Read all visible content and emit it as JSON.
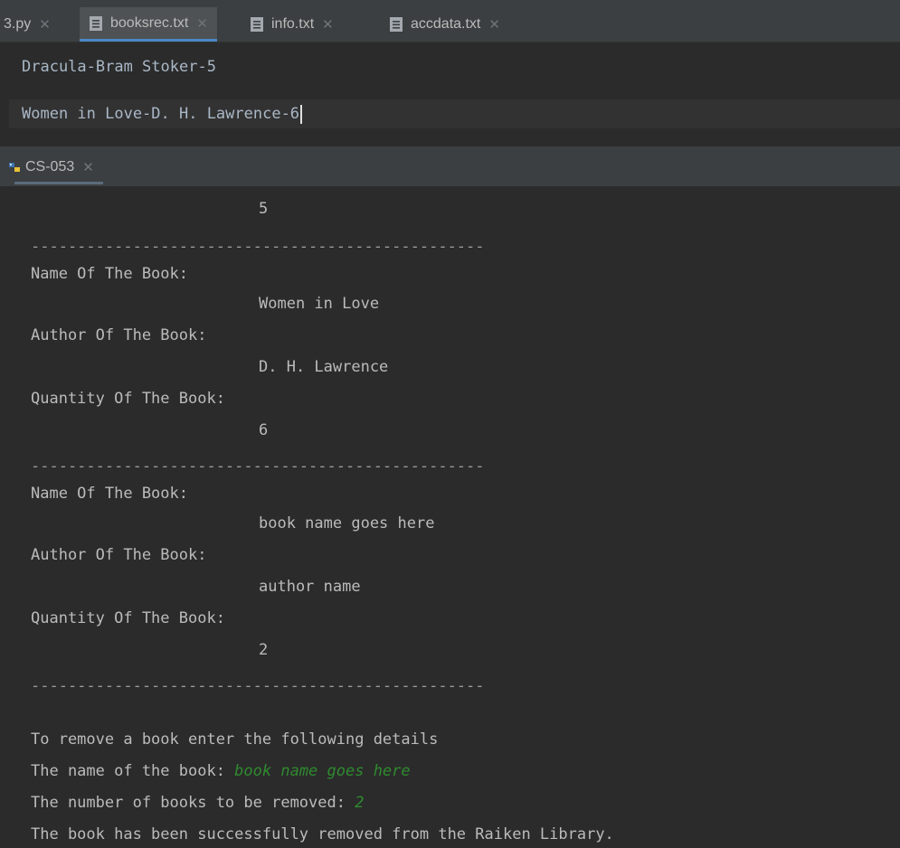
{
  "tabs": [
    {
      "label": "3.py",
      "active": false
    },
    {
      "label": "booksrec.txt",
      "active": true
    },
    {
      "label": "info.txt",
      "active": false
    },
    {
      "label": "accdata.txt",
      "active": false
    }
  ],
  "editor": {
    "lines": [
      "Dracula-Bram Stoker-5",
      "Women in Love-D. H. Lawrence-6"
    ]
  },
  "run": {
    "tab_label": "CS-053"
  },
  "console": {
    "first_value": "5",
    "separator": "-------------------------------------------------",
    "records": [
      {
        "name_label": "Name Of The Book:",
        "name": "Women in Love",
        "author_label": "Author Of The Book:",
        "author": "D. H. Lawrence",
        "qty_label": "Quantity Of The Book:",
        "qty": "6"
      },
      {
        "name_label": "Name Of The Book:",
        "name": "book name goes here",
        "author_label": "Author Of The Book:",
        "author": "author name",
        "qty_label": "Quantity Of The Book:",
        "qty": "2"
      }
    ],
    "prompt_intro": "To remove a book enter the following details",
    "prompt_name": "The name of the book: ",
    "input_name": "book name goes here",
    "prompt_count": "The number of books to be removed: ",
    "input_count": "2",
    "success": "The book has been successfully removed from the Raiken Library."
  },
  "colors": {
    "input_text": "#2f8a2f",
    "tab_underline": "#4a88c7"
  }
}
